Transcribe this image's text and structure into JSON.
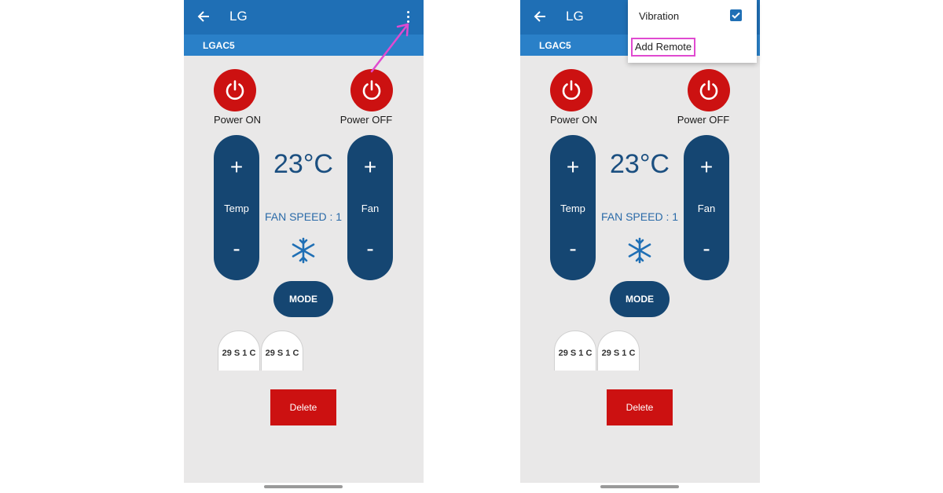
{
  "app": {
    "title": "LG",
    "device": "LGAC5"
  },
  "remote": {
    "power_on": "Power ON",
    "power_off": "Power OFF",
    "plus": "+",
    "minus": "-",
    "temp_label": "Temp",
    "fan_label": "Fan",
    "temperature": "23°C",
    "fan_speed": "FAN SPEED : 1",
    "mode": "MODE",
    "chips": [
      "29 S 1 C",
      "29 S 1 C"
    ],
    "delete": "Delete"
  },
  "menu": {
    "vibration": "Vibration",
    "vibration_checked": true,
    "add_remote": "Add Remote"
  },
  "icons": {
    "back": "arrow-left-icon",
    "overflow": "kebab-menu-icon",
    "power": "power-icon",
    "mode": "snowflake-icon",
    "check": "checkbox-checked-icon"
  },
  "colors": {
    "appbar": "#1f6fb5",
    "subbar": "#2a80c8",
    "button_dark": "#154672",
    "power_red": "#cc1111",
    "highlight": "#e04ad0",
    "arrow": "#e04ad0"
  }
}
